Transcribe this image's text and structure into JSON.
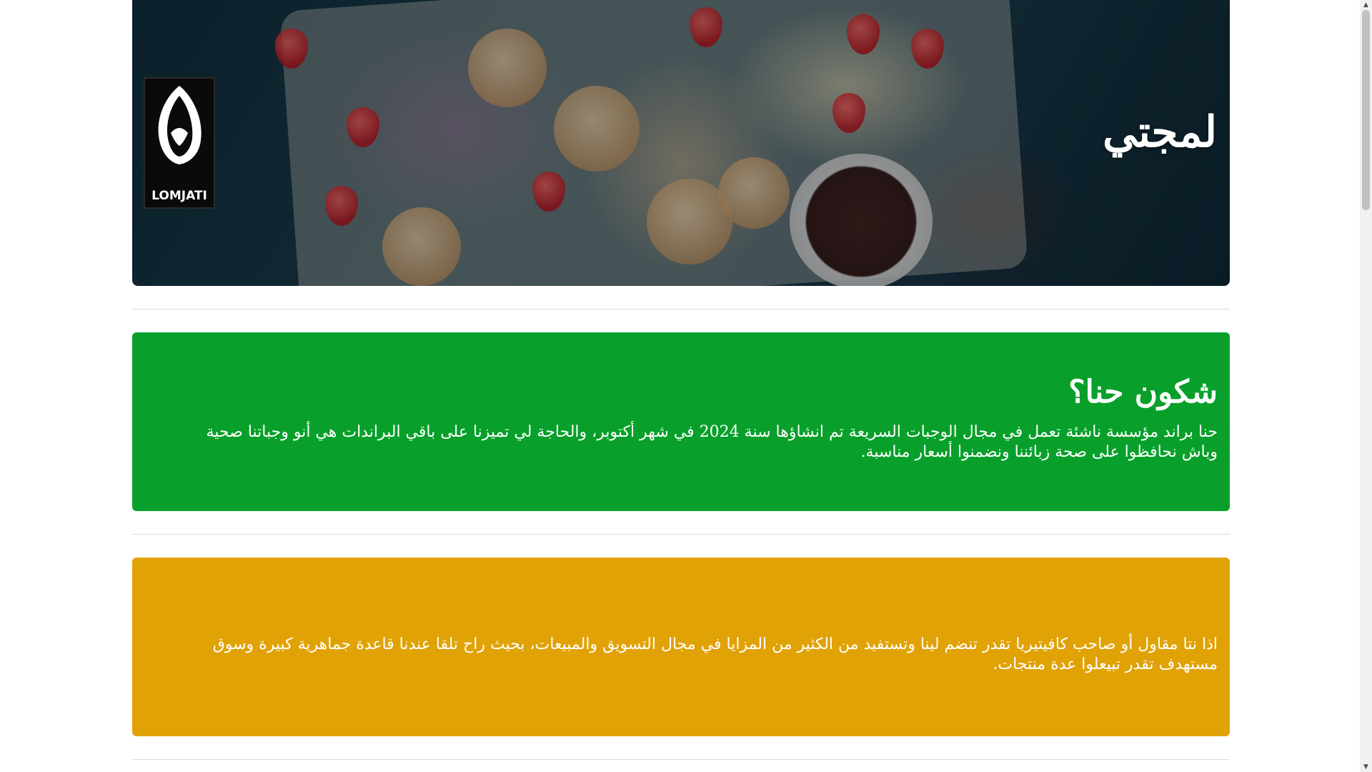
{
  "hero": {
    "title": "لمجتي",
    "logo_text": "LOMJATI",
    "image_alt": "food-platter"
  },
  "about": {
    "heading": "شكون حنا؟",
    "text": "حنا براند مؤسسة ناشئة تعمل في مجال الوجبات السريعة تم انشاؤها سنة 2024 في شهر أكتوبر، والحاجة لي تميزنا على باقي البراندات هي أنو وجباتنا صحية وباش نحافظوا على صحة زبائننا ونضمنوا أسعار مناسبة.",
    "color": "#08a02a"
  },
  "partner": {
    "text": "اذا نتا مقاول أو صاحب كافيتيريا تقدر تنضم لينا وتستفيد من الكثير من المزايا في مجال التسويق والمبيعات، بحيث راح تلقا عندنا قاعدة جماهرية كبيرة وسوق مستهدف تقدر تبيعلوا عدة منتجات.",
    "color": "#e1a206"
  },
  "scrollbar": {
    "up_icon": "scroll-up-arrow-icon",
    "down_icon": "scroll-down-arrow-icon"
  }
}
